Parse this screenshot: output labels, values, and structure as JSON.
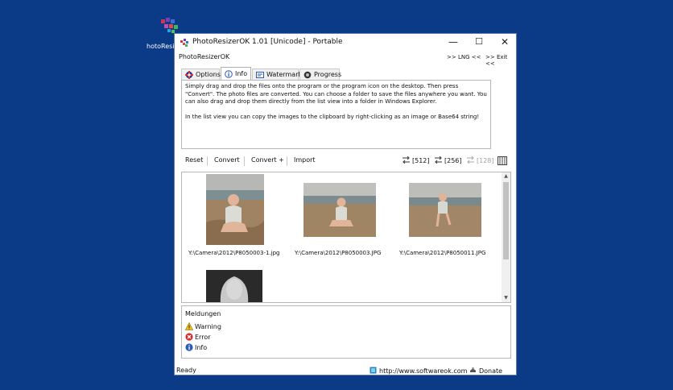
{
  "desktop": {
    "icon_label": "hotoResi"
  },
  "window": {
    "title": "PhotoResizerOK 1.01 [Unicode] - Portable",
    "controls": {
      "minimize": "—",
      "maximize": "☐",
      "close": "✕"
    }
  },
  "appbar": {
    "name": "PhotoResizerOK",
    "lng": ">> LNG <<",
    "exit": ">> Exit <<"
  },
  "tabs": [
    {
      "label": "Options",
      "icon": "gear-icon"
    },
    {
      "label": "Info",
      "icon": "info-icon"
    },
    {
      "label": "Watermark",
      "icon": "watermark-icon"
    },
    {
      "label": "Progress",
      "icon": "progress-icon"
    }
  ],
  "info": {
    "paragraph1": "Simply drag and drop the files onto the program or the program icon on the desktop. Then press \"Convert\". The photo files are converted. You can choose a folder to save the files anywhere you want. You can also drag and drop them directly from the list view into a folder in Windows Explorer.",
    "paragraph2": "In the list view you can copy the images to the clipboard by right-clicking as an image or Base64 string!"
  },
  "toolbar": {
    "reset": "Reset",
    "convert": "Convert",
    "convert_plus": "Convert +",
    "import": "Import",
    "size_512": "[512]",
    "size_256": "[256]",
    "size_128": "[128]"
  },
  "gallery": {
    "items": [
      {
        "caption": "Y:\\Camera\\2012\\P8050003-1.jpg"
      },
      {
        "caption": "Y:\\Camera\\2012\\P8050003.JPG"
      },
      {
        "caption": "Y:\\Camera\\2012\\P8050011.JPG"
      },
      {
        "caption": ""
      }
    ]
  },
  "messages": {
    "header": "Meldungen",
    "warning": "Warning",
    "error": "Error",
    "info": "Info"
  },
  "status": {
    "ready": "Ready",
    "url": "http://www.softwareok.com",
    "donate": "Donate"
  },
  "colors": {
    "desktop": "#0b3a86",
    "window_border": "#5a7ab0"
  }
}
